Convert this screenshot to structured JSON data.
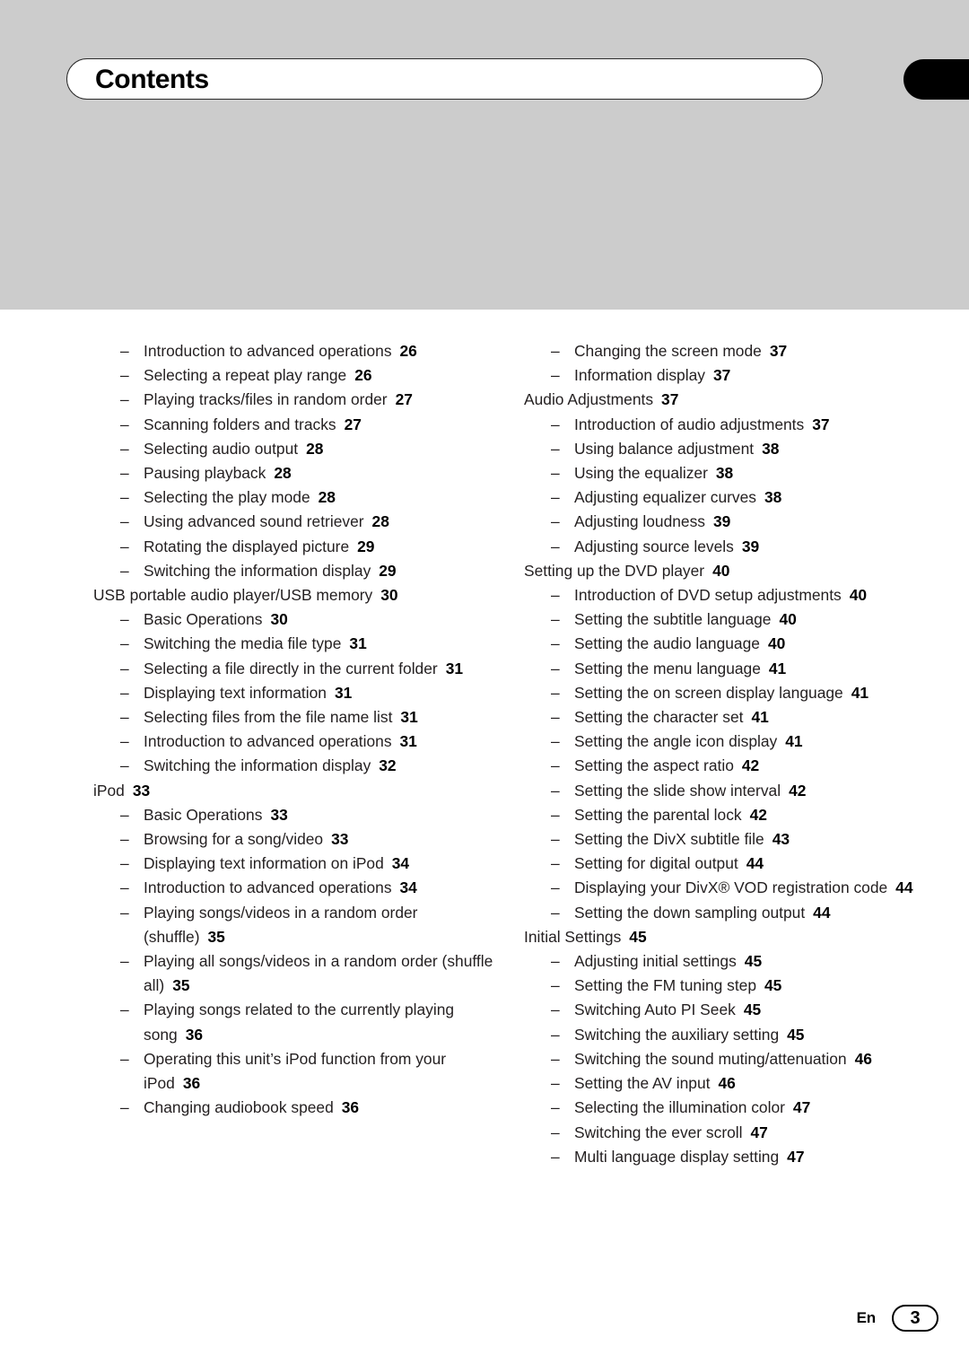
{
  "header": {
    "title": "Contents",
    "band_color": "#cccccc",
    "tab_color": "#000000"
  },
  "footer": {
    "language": "En",
    "page_number": "3"
  },
  "toc": {
    "left_column": [
      {
        "level": 1,
        "title": "Introduction to advanced operations",
        "page": "26"
      },
      {
        "level": 1,
        "title": "Selecting a repeat play range",
        "page": "26"
      },
      {
        "level": 1,
        "title": "Playing tracks/files in random order",
        "page": "27"
      },
      {
        "level": 1,
        "title": "Scanning folders and tracks",
        "page": "27"
      },
      {
        "level": 1,
        "title": "Selecting audio output",
        "page": "28"
      },
      {
        "level": 1,
        "title": "Pausing playback",
        "page": "28"
      },
      {
        "level": 1,
        "title": "Selecting the play mode",
        "page": "28"
      },
      {
        "level": 1,
        "title": "Using advanced sound retriever",
        "page": "28"
      },
      {
        "level": 1,
        "title": "Rotating the displayed picture",
        "page": "29"
      },
      {
        "level": 1,
        "title": "Switching the information display",
        "page": "29"
      },
      {
        "level": 0,
        "title": "USB portable audio player/USB memory",
        "page": "30"
      },
      {
        "level": 1,
        "title": "Basic Operations",
        "page": "30"
      },
      {
        "level": 1,
        "title": "Switching the media file type",
        "page": "31"
      },
      {
        "level": 1,
        "title": "Selecting a file directly in the current folder",
        "page": "31"
      },
      {
        "level": 1,
        "title": "Displaying text information",
        "page": "31"
      },
      {
        "level": 1,
        "title": "Selecting files from the file name list",
        "page": "31"
      },
      {
        "level": 1,
        "title": "Introduction to advanced operations",
        "page": "31"
      },
      {
        "level": 1,
        "title": "Switching the information display",
        "page": "32"
      },
      {
        "level": 0,
        "title": "iPod",
        "page": "33"
      },
      {
        "level": 1,
        "title": "Basic Operations",
        "page": "33"
      },
      {
        "level": 1,
        "title": "Browsing for a song/video",
        "page": "33"
      },
      {
        "level": 1,
        "title": "Displaying text information on iPod",
        "page": "34"
      },
      {
        "level": 1,
        "title": "Introduction to advanced operations",
        "page": "34"
      },
      {
        "level": 1,
        "title": "Playing songs/videos in a random order (shuffle)",
        "page": "35"
      },
      {
        "level": 1,
        "title": "Playing all songs/videos in a random order (shuffle all)",
        "page": "35"
      },
      {
        "level": 1,
        "title": "Playing songs related to the currently playing song",
        "page": "36"
      },
      {
        "level": 1,
        "title": "Operating this unit’s iPod function from your iPod",
        "page": "36"
      },
      {
        "level": 1,
        "title": "Changing audiobook speed",
        "page": "36"
      }
    ],
    "right_column": [
      {
        "level": 1,
        "title": "Changing the screen mode",
        "page": "37"
      },
      {
        "level": 1,
        "title": "Information display",
        "page": "37"
      },
      {
        "level": 0,
        "title": "Audio Adjustments",
        "page": "37"
      },
      {
        "level": 1,
        "title": "Introduction of audio adjustments",
        "page": "37"
      },
      {
        "level": 1,
        "title": "Using balance adjustment",
        "page": "38"
      },
      {
        "level": 1,
        "title": "Using the equalizer",
        "page": "38"
      },
      {
        "level": 1,
        "title": "Adjusting equalizer curves",
        "page": "38"
      },
      {
        "level": 1,
        "title": "Adjusting loudness",
        "page": "39"
      },
      {
        "level": 1,
        "title": "Adjusting source levels",
        "page": "39"
      },
      {
        "level": 0,
        "title": "Setting up the DVD player",
        "page": "40"
      },
      {
        "level": 1,
        "title": "Introduction of DVD setup adjustments",
        "page": "40"
      },
      {
        "level": 1,
        "title": "Setting the subtitle language",
        "page": "40"
      },
      {
        "level": 1,
        "title": "Setting the audio language",
        "page": "40"
      },
      {
        "level": 1,
        "title": "Setting the menu language",
        "page": "41"
      },
      {
        "level": 1,
        "title": "Setting the on screen display language",
        "page": "41"
      },
      {
        "level": 1,
        "title": "Setting the character set",
        "page": "41"
      },
      {
        "level": 1,
        "title": "Setting the angle icon display",
        "page": "41"
      },
      {
        "level": 1,
        "title": "Setting the aspect ratio",
        "page": "42"
      },
      {
        "level": 1,
        "title": "Setting the slide show interval",
        "page": "42"
      },
      {
        "level": 1,
        "title": "Setting the parental lock",
        "page": "42"
      },
      {
        "level": 1,
        "title": "Setting the DivX subtitle file",
        "page": "43"
      },
      {
        "level": 1,
        "title": "Setting for digital output",
        "page": "44"
      },
      {
        "level": 1,
        "title": "Displaying your DivX® VOD registration code",
        "page": "44"
      },
      {
        "level": 1,
        "title": "Setting the down sampling output",
        "page": "44"
      },
      {
        "level": 0,
        "title": "Initial Settings",
        "page": "45"
      },
      {
        "level": 1,
        "title": "Adjusting initial settings",
        "page": "45"
      },
      {
        "level": 1,
        "title": "Setting the FM tuning step",
        "page": "45"
      },
      {
        "level": 1,
        "title": "Switching Auto PI Seek",
        "page": "45"
      },
      {
        "level": 1,
        "title": "Switching the auxiliary setting",
        "page": "45"
      },
      {
        "level": 1,
        "title": "Switching the sound muting/attenuation",
        "page": "46"
      },
      {
        "level": 1,
        "title": "Setting the AV input",
        "page": "46"
      },
      {
        "level": 1,
        "title": "Selecting the illumination color",
        "page": "47"
      },
      {
        "level": 1,
        "title": "Switching the ever scroll",
        "page": "47"
      },
      {
        "level": 1,
        "title": "Multi language display setting",
        "page": "47"
      }
    ]
  }
}
